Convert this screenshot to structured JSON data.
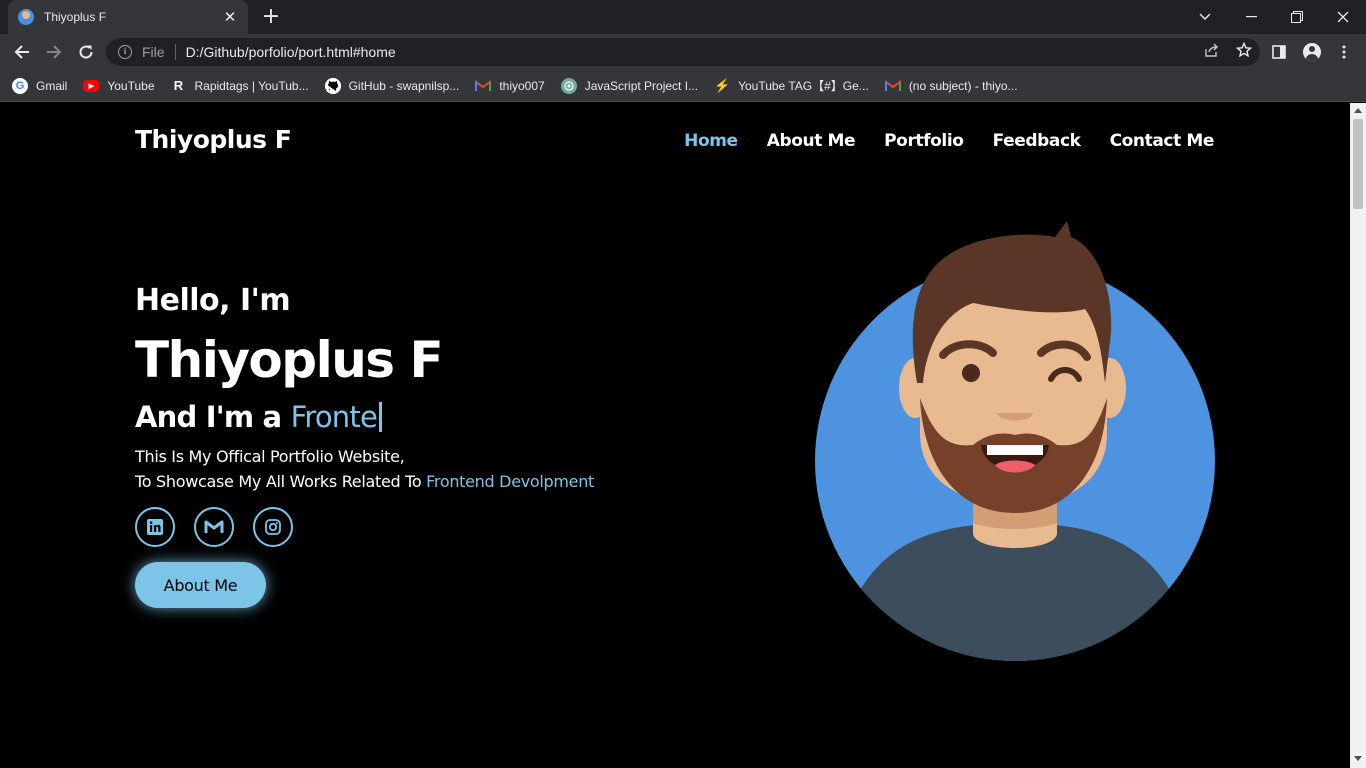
{
  "browser": {
    "tab_title": "Thiyoplus F",
    "tab_close": "✕",
    "new_tab": "+",
    "file_label": "File",
    "url": "D:/Github/porfolio/port.html#home",
    "bookmarks": [
      {
        "label": "Gmail",
        "icon": "google-icon"
      },
      {
        "label": "YouTube",
        "icon": "youtube-icon"
      },
      {
        "label": "Rapidtags | YouTub...",
        "icon": "rapidtags-icon"
      },
      {
        "label": "GitHub - swapnilsp...",
        "icon": "github-icon"
      },
      {
        "label": "thiyo007",
        "icon": "gmail-icon"
      },
      {
        "label": "JavaScript Project I...",
        "icon": "chatgpt-icon"
      },
      {
        "label": "YouTube TAG【#】Ge...",
        "icon": "tag-icon"
      },
      {
        "label": "(no subject) - thiyo...",
        "icon": "gmail-icon"
      }
    ]
  },
  "site": {
    "logo": "Thiyoplus F",
    "nav": [
      "Home",
      "About Me",
      "Portfolio",
      "Feedback",
      "Contact Me"
    ],
    "active_nav": "Home",
    "accent": "#7cc4e8"
  },
  "hero": {
    "greeting": "Hello, I'm",
    "name": "Thiyoplus F",
    "role_prefix": "And I'm a ",
    "role_typed": "Fronte",
    "desc_line1": "This Is My Offical Portfolio Website,",
    "desc_line2_prefix": "To Showcase My All Works Related To ",
    "desc_line2_highlight": "Frontend Devolpment",
    "socials": [
      "linkedin-icon",
      "gmail-icon",
      "instagram-icon"
    ],
    "button": "About Me"
  }
}
